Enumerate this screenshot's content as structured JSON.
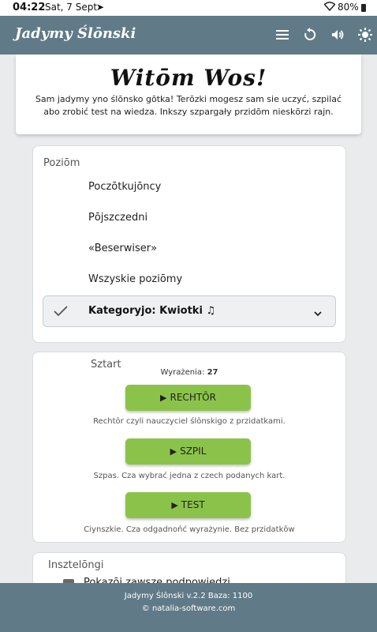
{
  "status_bar": {
    "time": "04:22",
    "date": "Sat, 7 Sept",
    "telegram_icon": "send-icon",
    "battery": "80%"
  },
  "app_bar": {
    "title": "Jadymy Ślōnski",
    "icons": [
      "menu-icon",
      "refresh-icon",
      "volume-icon",
      "brightness-icon"
    ]
  },
  "welcome": {
    "heading": "Witōm Wos!",
    "intro": "Sam jadymy yno ślōnsko gōtka! Terōzki mogesz sam sie uczyć, szpilać abo zrobić test na wiedza. Inkszy szpargały przidōm nieskōrzi rajn."
  },
  "level": {
    "label": "Poziōm",
    "options": [
      "Poczōtkujōncy",
      "Pōjszczedni",
      "«Beserwiser»",
      "Wszyskie poziōmy"
    ],
    "selected": "Kategoryjo: Kwiotki ♫"
  },
  "start": {
    "label": "Sztart",
    "count_label": "Wyrażenia:",
    "count_value": "27",
    "buttons": [
      {
        "label": "RECHTŌR",
        "desc": "Rechtōr czyli nauczyciel ślōnskigo z przidatkami."
      },
      {
        "label": "SZPIL",
        "desc": "Szpas. Cza wybrać jedna z czech podanych kart."
      },
      {
        "label": "TEST",
        "desc": "Ciynszkie. Cza odgadnońć wyrażynie. Bez przidatkōw"
      }
    ]
  },
  "settings": {
    "label": "Insztelōngi",
    "hint": "Pokazōj zawsze podpowiedzi"
  },
  "footer": {
    "version": "Jadymy Ślōnski v.2.2 Baza: 1100",
    "copyright": "© natalia-software.com"
  },
  "colors": {
    "app_bar": "#607b87",
    "button": "#8bc34a",
    "background": "#e9ebec"
  }
}
